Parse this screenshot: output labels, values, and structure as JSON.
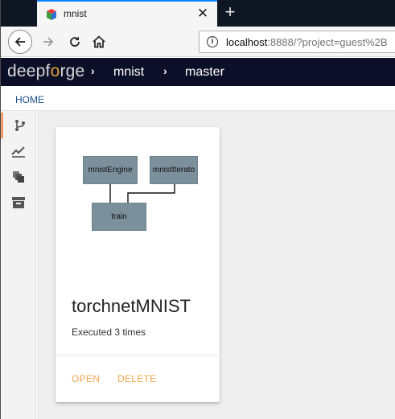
{
  "browser": {
    "tab_title": "mnist",
    "close_glyph": "✕",
    "new_tab_glyph": "+",
    "url_host": "localhost",
    "url_rest": ":8888/?project=guest%2B",
    "icons": [
      "favicon-icon",
      "close-icon",
      "plus-icon",
      "back-arrow-icon",
      "forward-arrow-icon",
      "reload-icon",
      "home-icon",
      "info-icon"
    ]
  },
  "app": {
    "logo_part1": "deepf",
    "logo_accent": "o",
    "logo_part2": "rge",
    "breadcrumbs": [
      "mnist",
      "master"
    ],
    "breadcrumb_sep": "›",
    "home_link": "HOME"
  },
  "rail": {
    "items": [
      "branch-icon",
      "chart-icon",
      "layers-icon",
      "archive-icon"
    ],
    "active_index": 0,
    "active_color": "#ef9d6a"
  },
  "card": {
    "title": "torchnetMNIST",
    "subtitle": "Executed 3 times",
    "actions": {
      "open": "OPEN",
      "delete": "DELETE"
    },
    "action_color": "#f0a54d",
    "diagram": {
      "nodes": {
        "engine": "mnistEngine",
        "iterator": "mnistIterato",
        "train": "train"
      },
      "node_color": "#7b909b"
    }
  }
}
